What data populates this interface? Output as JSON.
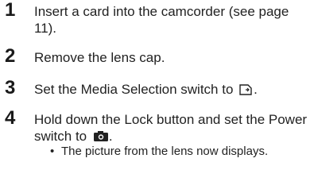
{
  "steps": [
    {
      "number": "1",
      "text": "Insert a card into the camcorder (see page 11)."
    },
    {
      "number": "2",
      "text": "Remove the lens cap."
    },
    {
      "number": "3",
      "text": "Set the Media Selection switch to",
      "icon": "card-media-icon",
      "suffix": "."
    },
    {
      "number": "4",
      "text": "Hold down the Lock button and set the Power switch to",
      "icon": "camera-icon",
      "suffix": "."
    }
  ],
  "bullet": {
    "symbol": "•",
    "text": "The picture from the lens now displays."
  },
  "colors": {
    "text": "#222222",
    "number": "#1a1a1a"
  }
}
